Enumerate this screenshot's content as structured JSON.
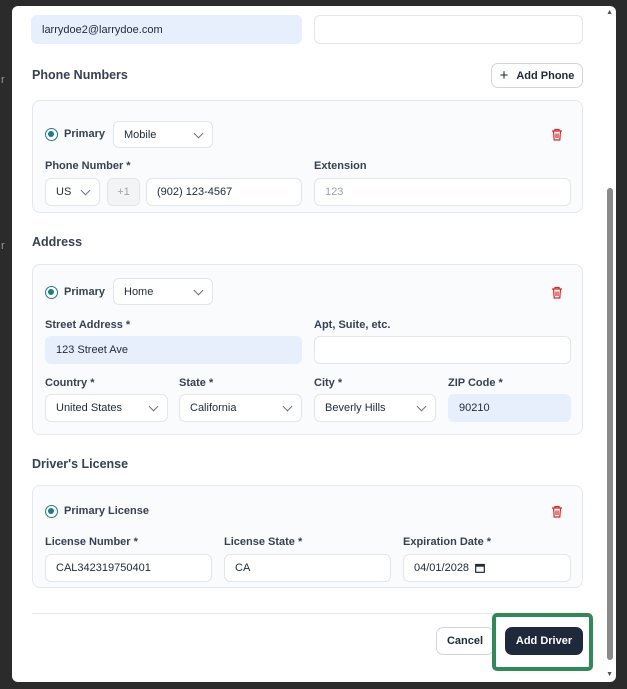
{
  "form": {
    "email_value": "larrydoe2@larrydoe.com",
    "employer_value": ""
  },
  "phone_section": {
    "title": "Phone Numbers",
    "add_label": "Add Phone",
    "primary_label": "Primary",
    "type_value": "Mobile",
    "number_label": "Phone Number *",
    "country_code": "US",
    "dial_prefix": "+1",
    "number_value": "(902) 123-4567",
    "extension_label": "Extension",
    "extension_placeholder": "123"
  },
  "address_section": {
    "title": "Address",
    "primary_label": "Primary",
    "type_value": "Home",
    "street_label": "Street Address *",
    "street_value": "123 Street Ave",
    "apt_label": "Apt, Suite, etc.",
    "apt_value": "",
    "country_label": "Country *",
    "country_value": "United States",
    "state_label": "State *",
    "state_value": "California",
    "city_label": "City *",
    "city_value": "Beverly Hills",
    "zip_label": "ZIP Code *",
    "zip_value": "90210"
  },
  "license_section": {
    "title": "Driver's License",
    "primary_label": "Primary License",
    "number_label": "License Number *",
    "number_value": "CAL342319750401",
    "state_label": "License State *",
    "state_value": "CA",
    "expiration_label": "Expiration Date *",
    "expiration_value": "04/01/2028"
  },
  "footer": {
    "cancel_label": "Cancel",
    "submit_label": "Add Driver"
  },
  "colors": {
    "accent": "#1f7a8c",
    "danger": "#dc2626",
    "primary_button": "#1e2a3b",
    "highlight": "#2e8b57",
    "filled_input": "#e8effc"
  }
}
